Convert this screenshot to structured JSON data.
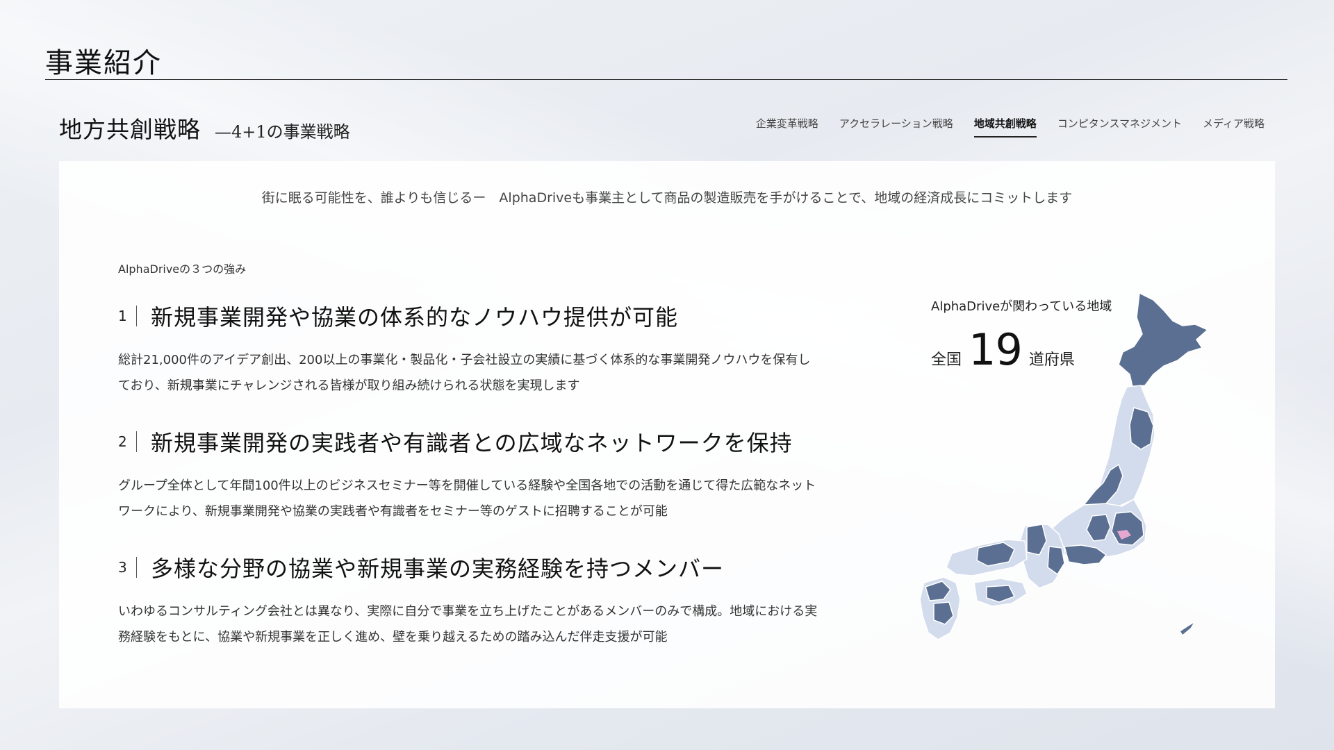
{
  "header": {
    "title": "事業紹介"
  },
  "section": {
    "title": "地方共創戦略",
    "subtitle": "—4+1の事業戦略"
  },
  "tabs": [
    {
      "label": "企業変革戦略",
      "active": false
    },
    {
      "label": "アクセラレーション戦略",
      "active": false
    },
    {
      "label": "地域共創戦略",
      "active": true
    },
    {
      "label": "コンピタンスマネジメント",
      "active": false
    },
    {
      "label": "メディア戦略",
      "active": false
    }
  ],
  "content": {
    "tagline": "街に眠る可能性を、誰よりも信じるー　AlphaDriveも事業主として商品の製造販売を手がけることで、地域の経済成長にコミットします",
    "strengths_label": "AlphaDriveの３つの強み",
    "points": [
      {
        "num": "1",
        "title": "新規事業開発や協業の体系的なノウハウ提供が可能",
        "body": "総計21,000件のアイデア創出、200以上の事業化・製品化・子会社設立の実績に基づく体系的な事業開発ノウハウを保有しており、新規事業にチャレンジされる皆様が取り組み続けられる状態を実現します"
      },
      {
        "num": "2",
        "title": "新規事業開発の実践者や有識者との広域なネットワークを保持",
        "body": "グループ全体として年間100件以上のビジネスセミナー等を開催している経験や全国各地での活動を通じて得た広範なネットワークにより、新規事業開発や協業の実践者や有識者をセミナー等のゲストに招聘することが可能"
      },
      {
        "num": "3",
        "title": "多様な分野の協業や新規事業の実務経験を持つメンバー",
        "body": "いわゆるコンサルティング会社とは異なり、実際に自分で事業を立ち上げたことがあるメンバーのみで構成。地域における実務経験をもとに、協業や新規事業を正しく進め、壁を乗り越えるための踏み込んだ伴走支援が可能"
      }
    ]
  },
  "map": {
    "label": "AlphaDriveが関わっている地域",
    "stat_prefix": "全国",
    "stat_number": "19",
    "stat_suffix": "道府県",
    "colors": {
      "base": "#d3dcec",
      "highlight": "#5a6f92",
      "accent": "#e6a8d0"
    }
  }
}
